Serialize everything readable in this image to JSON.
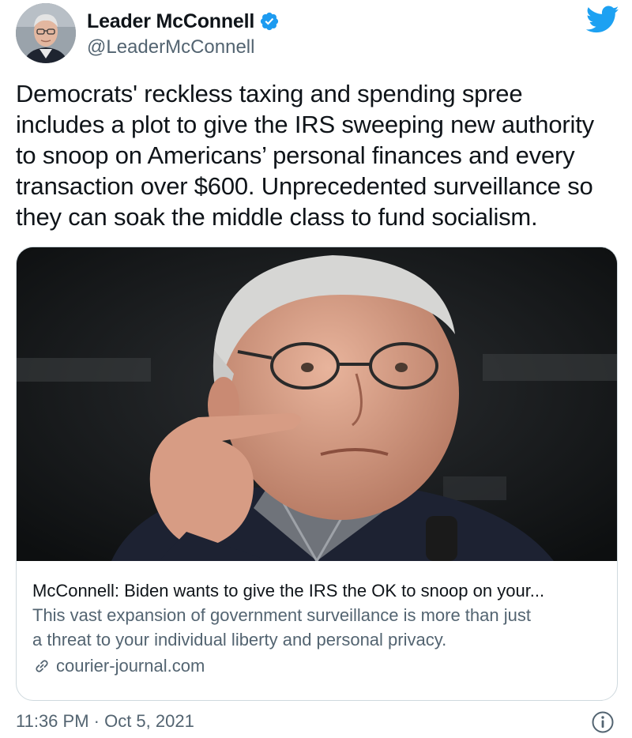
{
  "author": {
    "display_name": "Leader McConnell",
    "handle": "@LeaderMcConnell",
    "verified": true,
    "avatar_icon": "profile-photo"
  },
  "brand": {
    "logo_icon": "twitter-bird-icon",
    "color": "#1da1f2"
  },
  "tweet": {
    "text_lines": [
      "Democrats' reckless taxing and spending spree",
      "includes a plot to give the IRS sweeping new authority",
      "to snoop on Americans’ personal finances and every",
      "transaction over $600. Unprecedented surveillance so",
      "they can soak the middle class to fund socialism."
    ]
  },
  "link_card": {
    "title": "McConnell: Biden wants to give the IRS the OK to snoop on your...",
    "description_lines": [
      "This vast expansion of government surveillance is more than just",
      "a threat to your individual liberty and personal privacy."
    ],
    "domain": "courier-journal.com",
    "domain_icon": "link-icon",
    "image_icon": "article-photo"
  },
  "footer": {
    "timestamp": "11:36 PM · Oct 5, 2021",
    "info_icon": "info-icon"
  },
  "colors": {
    "text_primary": "#0f1419",
    "text_secondary": "#536471",
    "verified_blue": "#1d9bf0",
    "border": "#cfd9de"
  }
}
